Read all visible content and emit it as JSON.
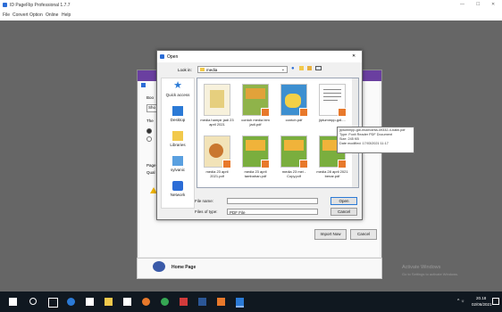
{
  "app": {
    "title": "ID PageFlip Professional 1.7.7",
    "menu": [
      "File",
      "Convert",
      "Option",
      "Online",
      "Help"
    ],
    "window_controls": {
      "minimize": "—",
      "maximize": "☐",
      "close": "✕"
    }
  },
  "wizard": {
    "labels": [
      "Boo",
      "Sho",
      "The",
      "Page",
      "Qual"
    ],
    "buttons": {
      "import": "Import Now",
      "cancel": "Cancel"
    },
    "home_page": "Home Page"
  },
  "open_dialog": {
    "title": "Open",
    "close": "✕",
    "look_in_label": "Look in:",
    "look_in_value": "media",
    "places": [
      "Quick access",
      "Desktop",
      "Libraries",
      "sylvanic",
      "Network"
    ],
    "files": [
      {
        "name": "media hampir jadi 23 april 2021",
        "thumb": "doc"
      },
      {
        "name": "contoh media blm jadi.pdf",
        "thumb": "green"
      },
      {
        "name": "contoh.pdf",
        "thumb": "cartoon"
      },
      {
        "name": "jiptummpp-gdl-...",
        "thumb": "text"
      },
      {
        "name": "media 23 april 2021.pdf",
        "thumb": "food"
      },
      {
        "name": "media 23 april tambahan.pdf",
        "thumb": "green"
      },
      {
        "name": "media 23 mei - Copy.pdf",
        "thumb": "green"
      },
      {
        "name": "media 28 april 2021 benar.pdf",
        "thumb": "green"
      }
    ],
    "file_name_label": "File name:",
    "file_name_value": "",
    "file_type_label": "Files of type:",
    "file_type_value": "PDF File",
    "open_button": "Open",
    "cancel_button": "Cancel"
  },
  "tooltip": [
    "jiptummpp-gdl-mukhoirita-49332-4-babii.pdf",
    "Type: Foxit Reader PDF Document",
    "Size: 245 KB",
    "Date modified: 17/03/2021 11:17"
  ],
  "watermark": {
    "line1": "Activate Windows",
    "line2": "Go to Settings to activate Windows."
  },
  "taskbar": {
    "time": "20.18",
    "date": "02/06/2021"
  },
  "colors": {
    "wizard_header": "#6a3fa0",
    "pdf_badge": "#e8792b",
    "folder": "#f2c94c",
    "taskbar": "#101820"
  }
}
